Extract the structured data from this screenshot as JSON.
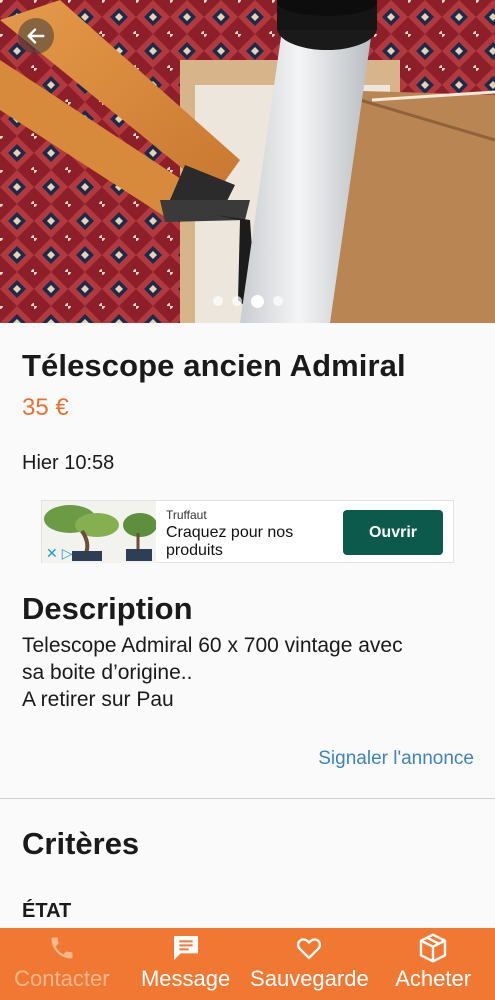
{
  "listing": {
    "title": "Télescope ancien Admiral",
    "price": "35 €",
    "date": "Hier 10:58",
    "description_heading": "Description",
    "description_lines": [
      "Telescope Admiral 60 x 700 vintage avec",
      "sa boite d’origine..",
      "A retirer sur Pau"
    ],
    "report_link": "Signaler l'annonce",
    "criteria_heading": "Critères",
    "criteria_first_label": "ÉTAT"
  },
  "gallery": {
    "photo_count": 4,
    "active_index": 2
  },
  "ad": {
    "brand": "Truffaut",
    "text": "Craquez pour nos produits",
    "cta": "Ouvrir"
  },
  "bottom_bar": {
    "items": [
      {
        "label": "Contacter",
        "icon": "phone-icon",
        "enabled": false
      },
      {
        "label": "Message",
        "icon": "message-icon",
        "enabled": true
      },
      {
        "label": "Sauvegarde",
        "icon": "heart-icon",
        "enabled": true
      },
      {
        "label": "Acheter",
        "icon": "package-icon",
        "enabled": true
      }
    ]
  },
  "colors": {
    "accent": "#f07832",
    "price": "#e8722f",
    "link": "#3c84bf",
    "ad_button": "#0c5a4b"
  }
}
